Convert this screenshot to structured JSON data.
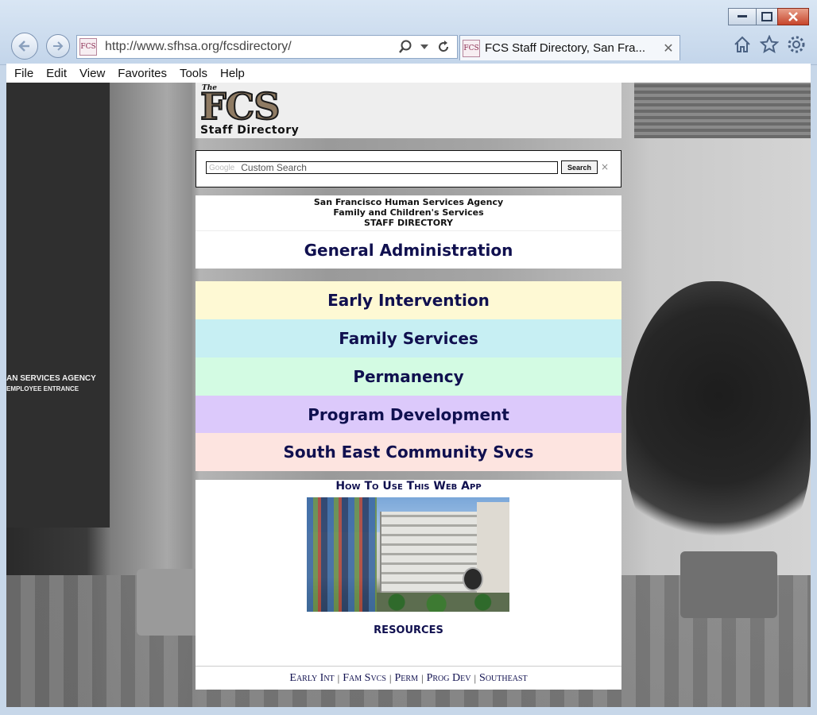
{
  "browser": {
    "url": "http://www.sfhsa.org/fcsdirectory/",
    "tab_title": "FCS Staff Directory, San Fra...",
    "favicon_text": "FCS",
    "menu": [
      "File",
      "Edit",
      "View",
      "Favorites",
      "Tools",
      "Help"
    ]
  },
  "background": {
    "sign_line1": "AN SERVICES AGENCY",
    "sign_line2": "EMPLOYEE ENTRANCE"
  },
  "logo": {
    "the": "The",
    "fcs": "FCS",
    "subtitle": "Staff Directory"
  },
  "search": {
    "brand": "Google",
    "placeholder": "Custom Search",
    "button_label": "Search",
    "clear": "×"
  },
  "header": {
    "line1": "San Francisco Human Services Agency",
    "line2": "Family and Children's Services",
    "line3": "STAFF DIRECTORY"
  },
  "sections": {
    "general": "General Administration",
    "items": [
      {
        "label": "Early Intervention",
        "color": "#fef9d4"
      },
      {
        "label": "Family Services",
        "color": "#c7eff3"
      },
      {
        "label": "Permanency",
        "color": "#d3fbe3"
      },
      {
        "label": "Program Development",
        "color": "#dcc9fb"
      },
      {
        "label": "South East Community Svcs",
        "color": "#fde4e0"
      }
    ]
  },
  "bottom": {
    "howto": "How To Use This Web App",
    "resources": "RESOURCES"
  },
  "footer": {
    "links": [
      "Early Int",
      "Fam Svcs",
      "Perm",
      "Prog Dev",
      "Southeast"
    ],
    "separator": "|"
  },
  "colors": {
    "link_navy": "#10104f"
  }
}
